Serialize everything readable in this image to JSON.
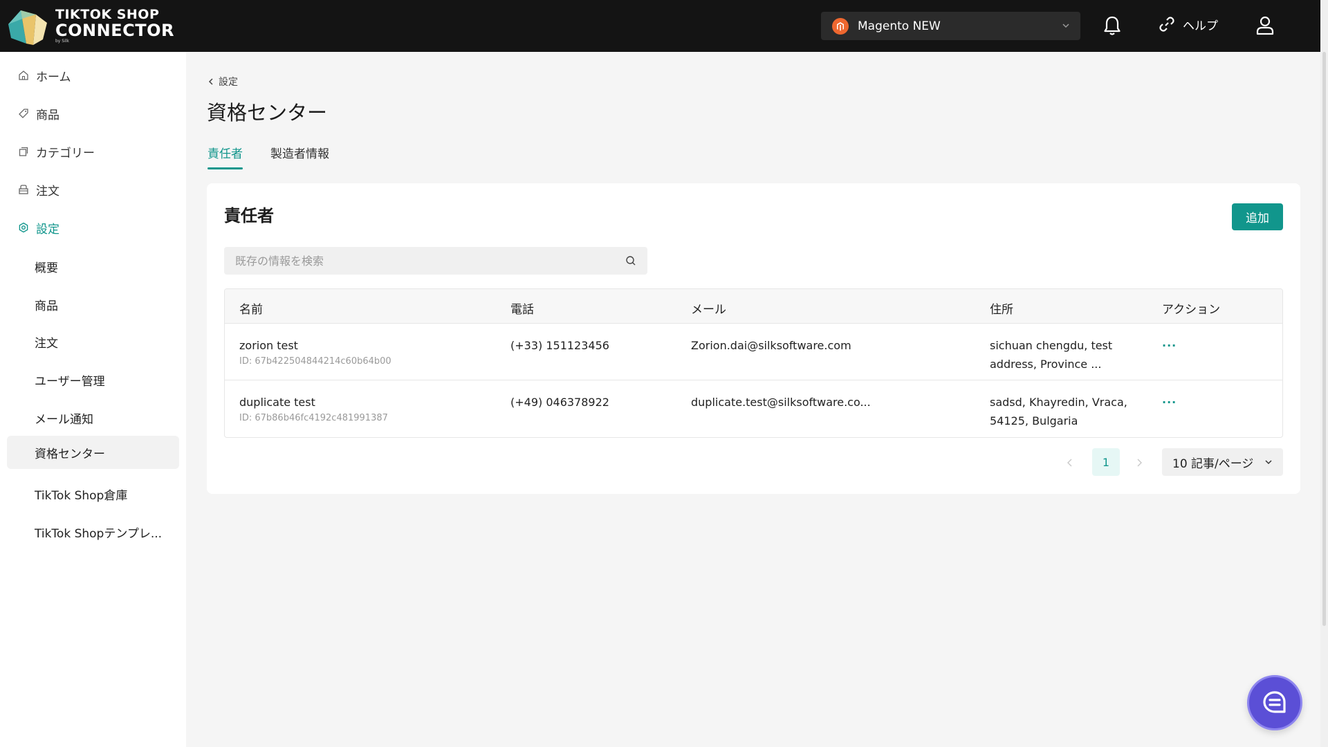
{
  "header": {
    "logo_line1": "TIKTOK SHOP",
    "logo_line2": "CONNECTOR",
    "logo_by": "by Silk",
    "store_name": "Magento NEW",
    "help_label": "ヘルプ"
  },
  "sidebar": {
    "top_items": [
      {
        "label": "ホーム",
        "icon": "home-icon"
      },
      {
        "label": "商品",
        "icon": "tag-icon"
      },
      {
        "label": "カテゴリー",
        "icon": "category-icon"
      },
      {
        "label": "注文",
        "icon": "order-icon"
      },
      {
        "label": "設定",
        "icon": "settings-icon"
      }
    ],
    "sub_items": [
      {
        "label": "概要"
      },
      {
        "label": "商品"
      },
      {
        "label": "注文"
      },
      {
        "label": "ユーザー管理"
      },
      {
        "label": "メール通知"
      },
      {
        "label": "資格センター"
      },
      {
        "label": "TikTok Shop倉庫"
      },
      {
        "label": "TikTok Shopテンプレ..."
      }
    ]
  },
  "main": {
    "breadcrumb": "設定",
    "title": "資格センター",
    "tabs": [
      {
        "label": "責任者"
      },
      {
        "label": "製造者情報"
      }
    ],
    "card": {
      "title": "責任者",
      "add_label": "追加",
      "search_placeholder": "既存の情報を検索",
      "columns": [
        "名前",
        "電話",
        "メール",
        "住所",
        "アクション"
      ],
      "rows": [
        {
          "name": "zorion test",
          "id": "ID: 67b422504844214c60b64b00",
          "phone": "(+33) 151123456",
          "email": "Zorion.dai@silksoftware.com",
          "address": "sichuan chengdu, test address, Province ...",
          "action": "···"
        },
        {
          "name": "duplicate test",
          "id": "ID: 67b86b46fc4192c481991387",
          "phone": "(+49) 046378922",
          "email": "duplicate.test@silksoftware.co...",
          "address": "sadsd, Khayredin, Vraca, 54125, Bulgaria",
          "action": "···"
        }
      ],
      "pagination": {
        "current_page": "1",
        "page_size": "10 記事/ページ"
      }
    }
  },
  "colors": {
    "accent": "#11968c",
    "topbar": "#141414",
    "chat_button": "#5b4fd6",
    "magento": "#ee672f"
  }
}
